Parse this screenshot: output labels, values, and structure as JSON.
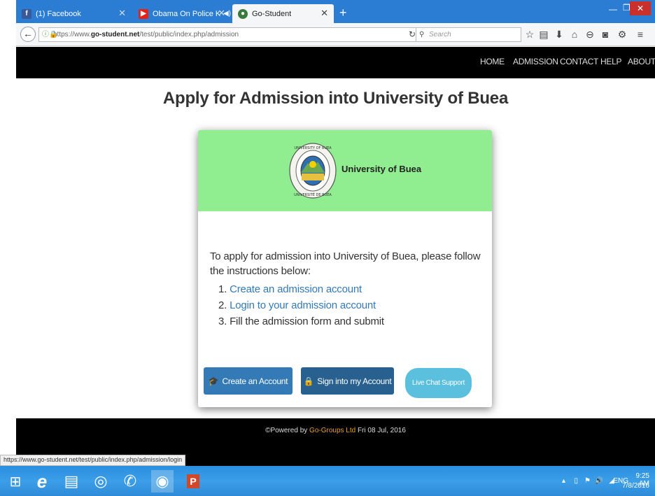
{
  "browser": {
    "tabs": [
      {
        "label": "(1) Facebook",
        "favicon": "facebook-icon"
      },
      {
        "label": "Obama On Police Killi...",
        "favicon": "youtube-icon"
      },
      {
        "label": "Go-Student",
        "favicon": "go-student-icon",
        "active": true
      }
    ],
    "new_tab_symbol": "+",
    "url_prefix": "https://www.",
    "url_domain": "go-student.net",
    "url_path": "/test/public/index.php/admission",
    "search_placeholder": "Search"
  },
  "site": {
    "nav": [
      "HOME",
      "ADMISSION",
      "CONTACT",
      "HELP",
      "ABOUT"
    ],
    "page_title": "Apply for Admission into University of Buea",
    "university_name": "University of Buea",
    "intro": "To apply for admission into University of Buea, please follow the instructions below:",
    "steps": [
      {
        "num": "1.",
        "text": "Create an admission account",
        "link": true
      },
      {
        "num": "2.",
        "text": "Login to your admission account",
        "link": true
      },
      {
        "num": "3.",
        "text": "Fill the admission form and submit",
        "link": false
      }
    ],
    "buttons": {
      "create": "Create an Account",
      "signin": "Sign into my Account",
      "chat": "Live Chat Support"
    },
    "footer": {
      "prefix": "©Powered by ",
      "brand": "Go-Groups Ltd",
      "suffix": " Fri 08 Jul, 2016"
    }
  },
  "status_url": "https://www.go-student.net/test/public/index.php/admission/login",
  "taskbar": {
    "lang": "ENG",
    "time": "9:25 AM",
    "date": "7/8/2016"
  },
  "colors": {
    "tabbar": "#2b7cd3",
    "card_header": "#90ee90",
    "primary": "#337ab7",
    "info": "#5bc0de",
    "footer_brand": "#e8a030"
  }
}
